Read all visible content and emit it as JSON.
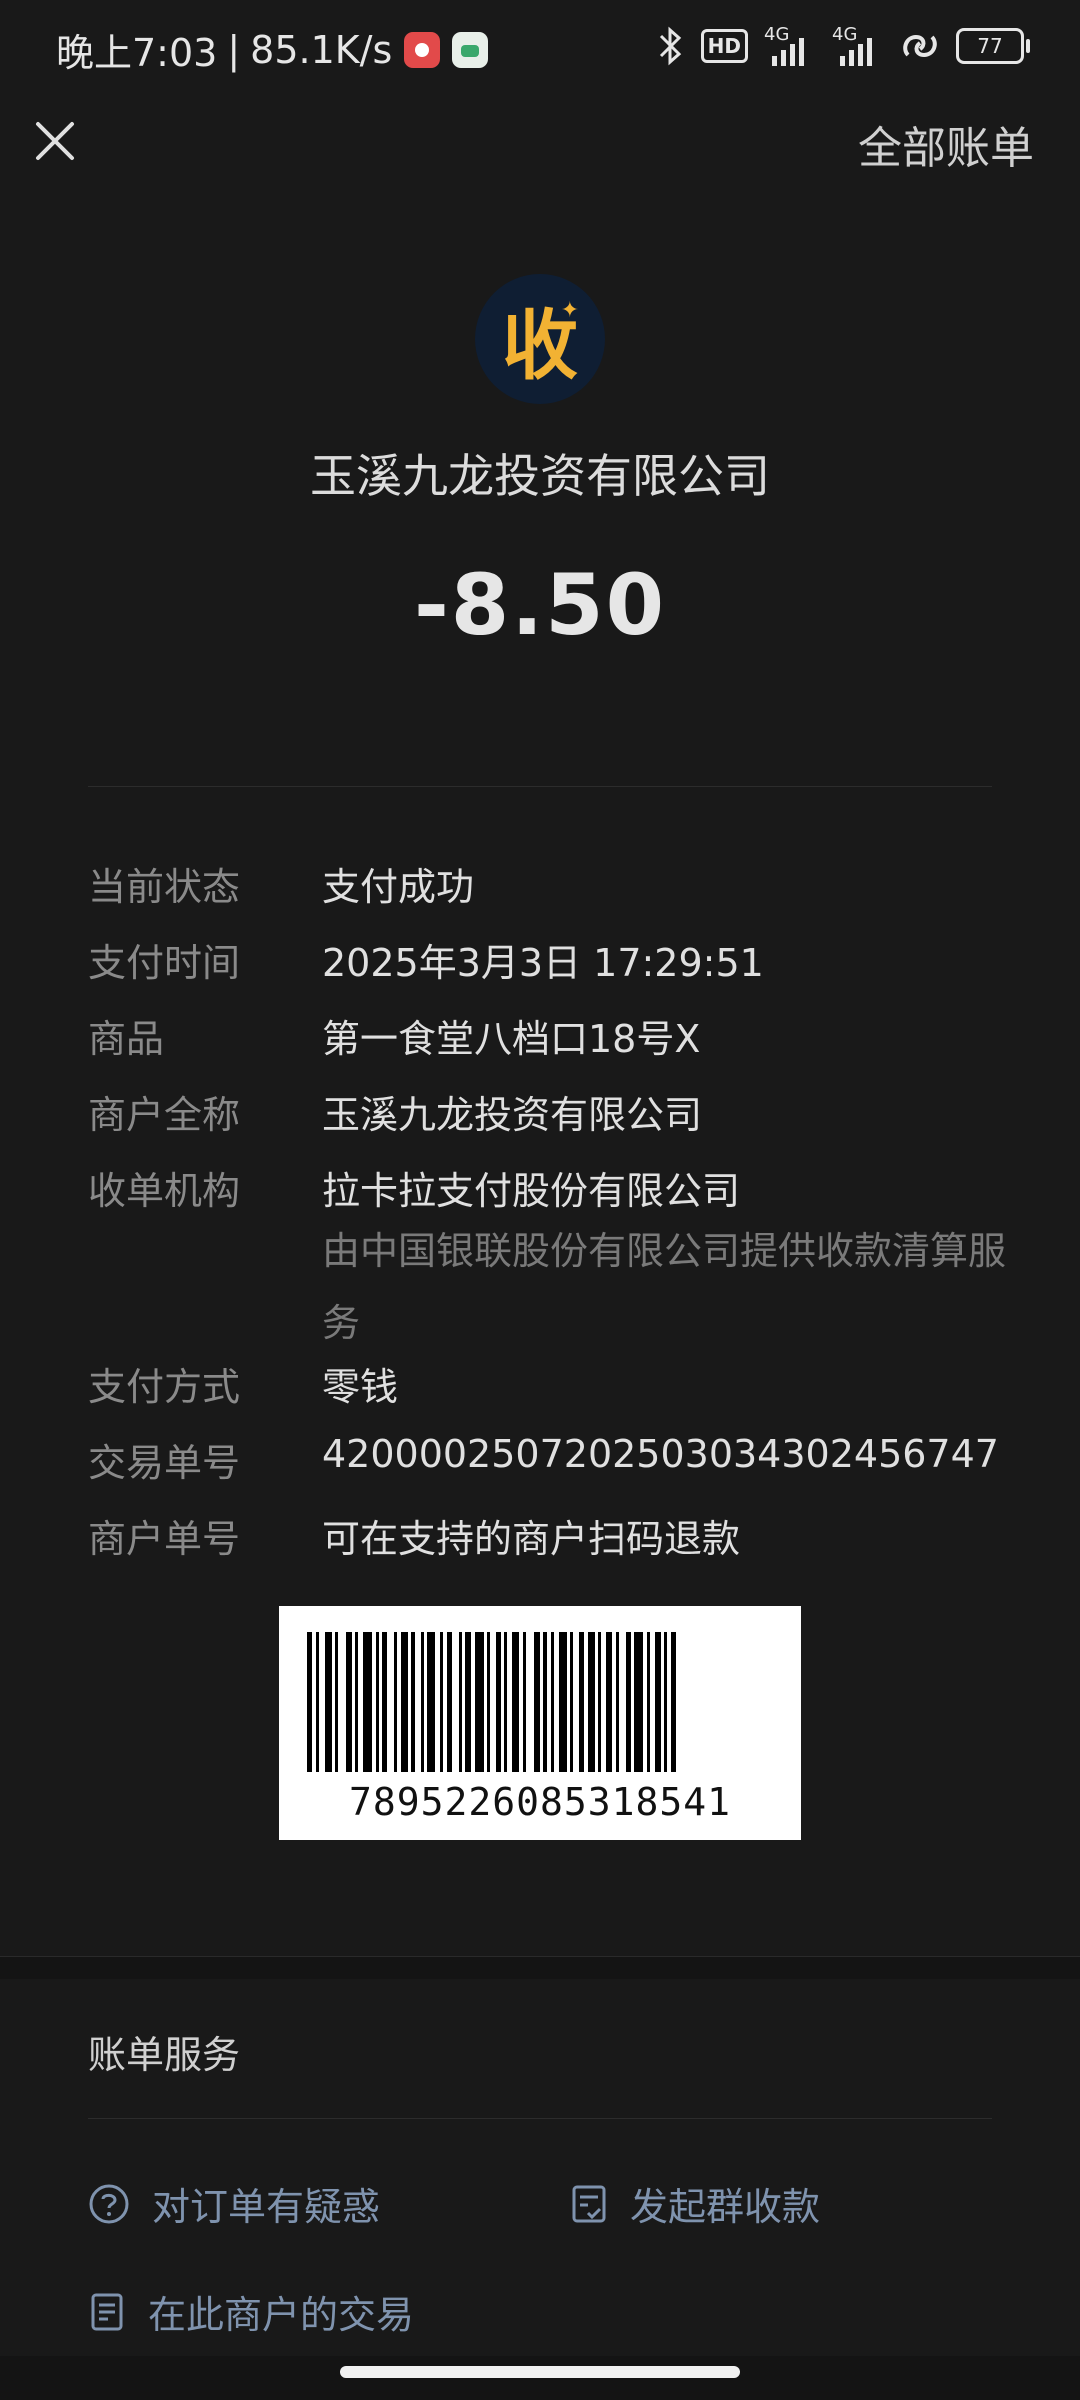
{
  "status_bar": {
    "time": "晚上7:03",
    "speed": "85.1K/s",
    "network_hd": "HD",
    "network_1": "4G",
    "network_2": "4G",
    "battery": "77"
  },
  "top_bar": {
    "close_icon": "close-icon",
    "all_bills_label": "全部账单"
  },
  "header": {
    "logo_text": "收",
    "merchant_name": "玉溪九龙投资有限公司",
    "amount": "-8.50"
  },
  "details": [
    {
      "label": "当前状态",
      "value": "支付成功"
    },
    {
      "label": "支付时间",
      "value": "2025年3月3日 17:29:51"
    },
    {
      "label": "商品",
      "value": "第一食堂八档口18号X"
    },
    {
      "label": "商户全称",
      "value": "玉溪九龙投资有限公司"
    },
    {
      "label": "收单机构",
      "value": "拉卡拉支付股份有限公司",
      "sub_value": "由中国银联股份有限公司提供收款清算服务"
    },
    {
      "label": "支付方式",
      "value": "零钱"
    },
    {
      "label": "交易单号",
      "value": "4200002507202503034302456747"
    },
    {
      "label": "商户单号",
      "value": "可在支持的商户扫码退款"
    }
  ],
  "barcode": {
    "number": "7895226085318541"
  },
  "services": {
    "title": "账单服务",
    "items": [
      {
        "label": "对订单有疑惑",
        "icon": "question-circle-icon"
      },
      {
        "label": "发起群收款",
        "icon": "checklist-icon"
      },
      {
        "label": "在此商户的交易",
        "icon": "document-icon"
      }
    ]
  }
}
